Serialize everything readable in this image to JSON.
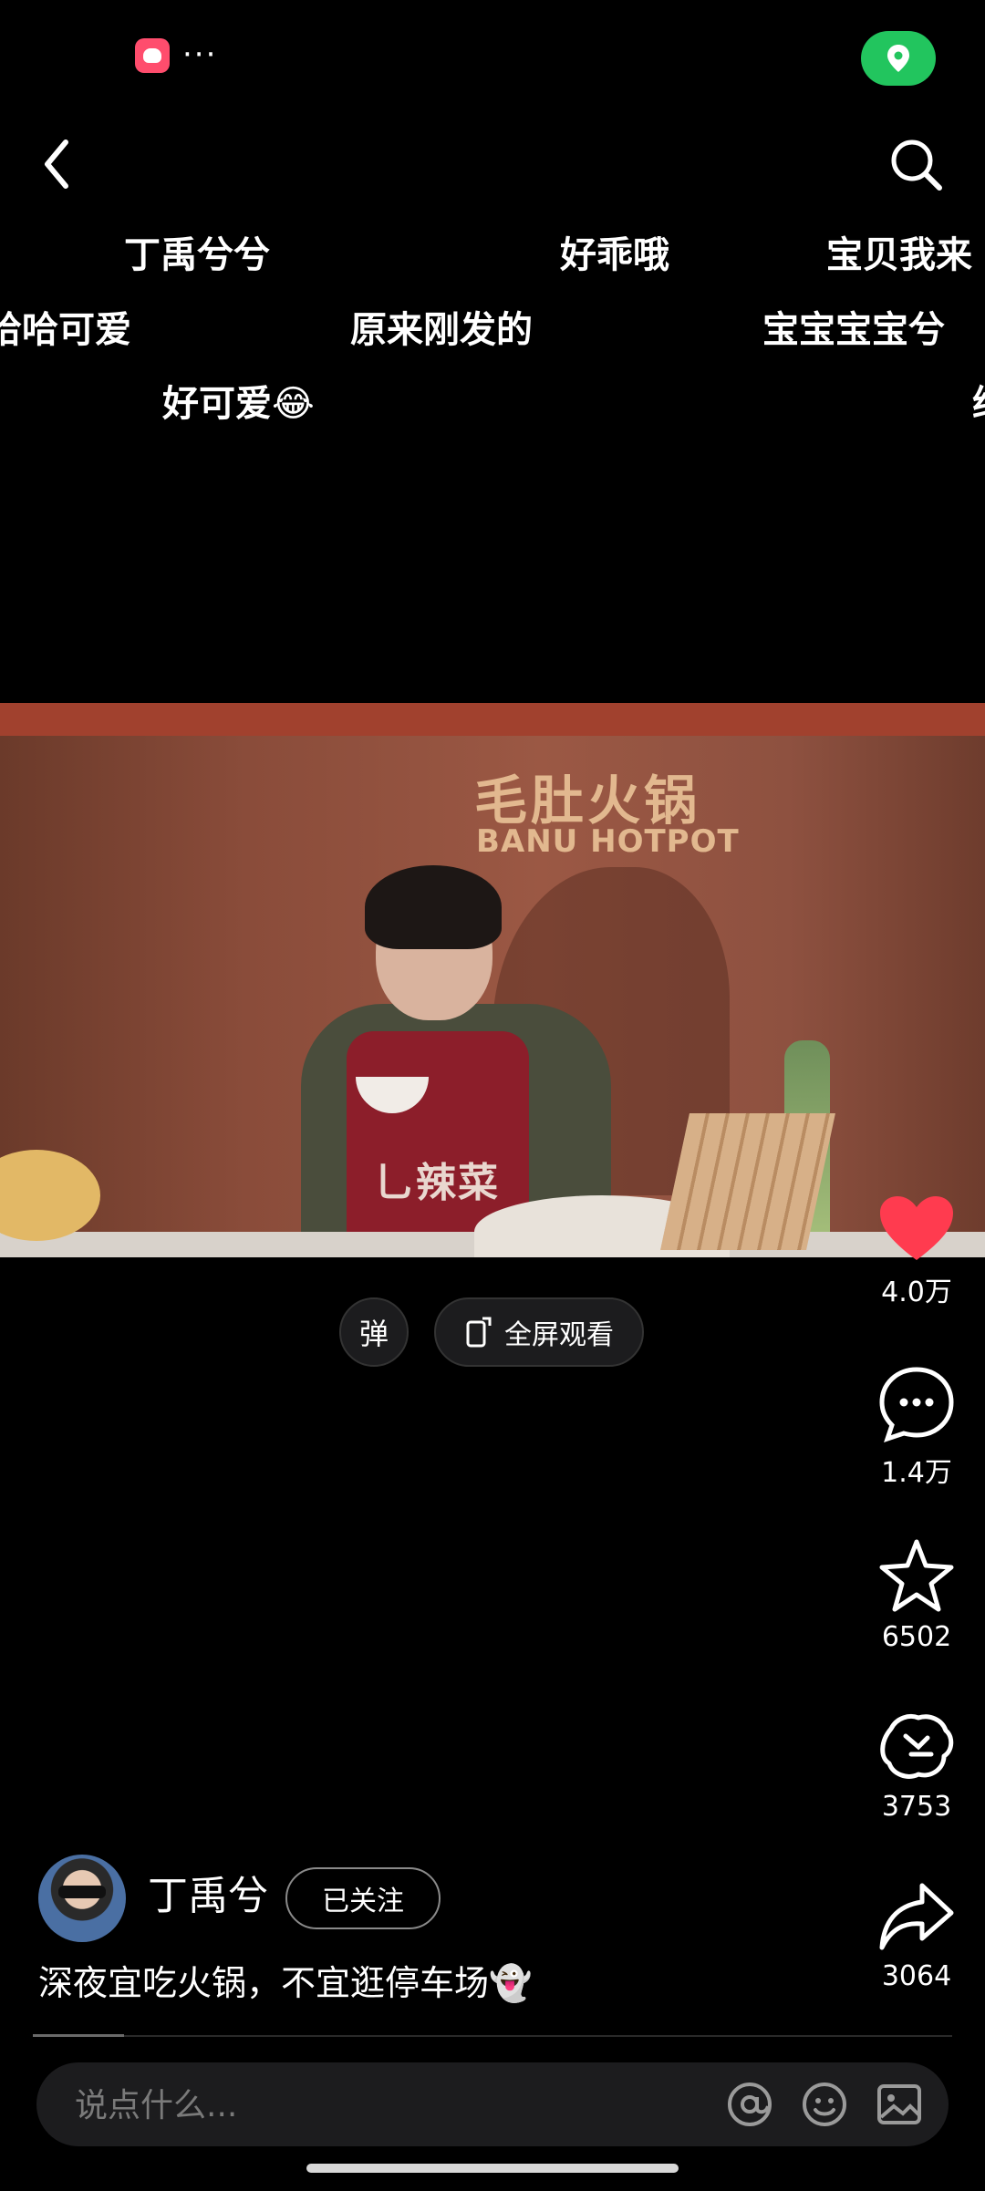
{
  "status_bar": {
    "more": "···",
    "location_icon": "location-pin-icon",
    "location_pill_color": "#22c55e"
  },
  "nav": {
    "back_icon": "chevron-left-icon",
    "search_icon": "search-icon"
  },
  "danmaku": [
    "丁禹兮兮",
    "好乖哦",
    "宝贝我来",
    "哈哈可爱",
    "原来刚发的",
    "宝宝宝宝兮",
    "好可爱😂",
    "给"
  ],
  "video": {
    "sign_text": "毛肚火锅",
    "sign_subtext": "BANU HOTPOT",
    "apron_text": "乚辣菜"
  },
  "controls": {
    "danmaku_toggle": "弹",
    "fullscreen_label": "全屏观看"
  },
  "actions": {
    "like": {
      "icon": "heart-icon",
      "count": "4.0万",
      "color": "#ff3b4f"
    },
    "comment": {
      "icon": "comment-icon",
      "count": "1.4万"
    },
    "favorite": {
      "icon": "star-icon",
      "count": "6502"
    },
    "repost": {
      "icon": "repost-icon",
      "count": "3753"
    },
    "share": {
      "icon": "share-arrow-icon",
      "count": "3064"
    }
  },
  "author": {
    "name": "丁禹兮",
    "follow_label": "已关注"
  },
  "caption": "深夜宜吃火锅，不宜逛停车场👻",
  "comment_bar": {
    "placeholder": "说点什么...",
    "icons": [
      "at-icon",
      "emoji-icon",
      "image-icon"
    ]
  }
}
